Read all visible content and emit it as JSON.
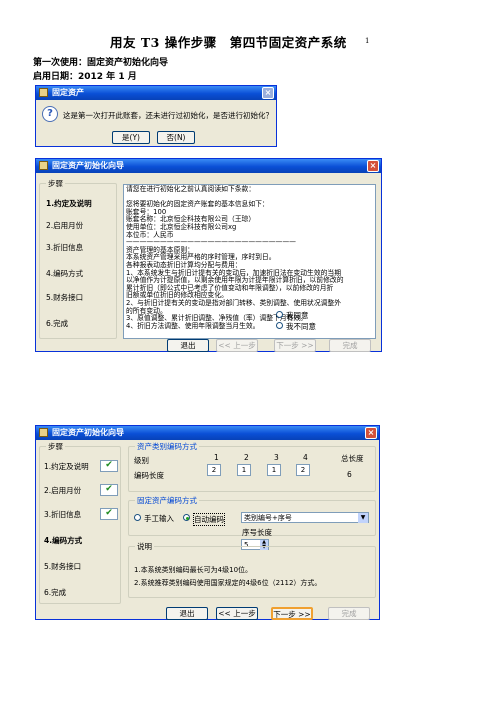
{
  "document": {
    "title": "用友 T3 操作步骤　第四节固定资产系统",
    "page_number": "1",
    "first_use": "第一次使用：固定资产初始化向导",
    "start_date": "启用日期：2012 年 1 月"
  },
  "dialog1": {
    "title": "固定资产",
    "message": "这是第一次打开此账套，还未进行过初始化，是否进行初始化？",
    "yes_label": "是(Y)",
    "no_label": "否(N)"
  },
  "wizard1": {
    "title": "固定资产初始化向导",
    "steps_group": "步骤",
    "steps": [
      "1.约定及说明",
      "2.启用月份",
      "3.折旧信息",
      "4.编码方式",
      "5.财务接口",
      "6.完成"
    ],
    "text_lines": [
      "请您在进行初始化之前认真阅读如下条款：",
      "",
      "您将要初始化的固定资产账套的基本信息如下：",
      "账套号：100",
      "账套名称：北京恒企科技有限公司（王琼）",
      "使用单位：北京恒企科技有限公司xg",
      "本位币：人民币",
      "—————————————————————————",
      "资产管理的基本原则：",
      "本系统资产管理采用严格的序时管理，序时到日。",
      "各种报表动态折旧计算均分配与费用：",
      "1、本系统发生与折旧计提有关的变动后，加速折旧法在变动生效的当期",
      "以净值作为计提原值，以剩余使用年限为计提年限计算折旧，以前修改的",
      "累计折旧（即公式中已考虑了价值变动和年限调整），以前修改的月折",
      "旧额或单位折旧的修改相应变化。",
      "2、与折旧计提有关的变动是指对部门转移、类别调整、使用状况调整外",
      "的所有变动。",
      "3、原值调整、累计折旧调整、净残值（率）调整下月有效。",
      "4、折旧方法调整、使用年限调整当月生效。"
    ],
    "agree_label": "我同意",
    "disagree_label": "我不同意",
    "exit_label": "退出",
    "prev_label": "<< 上一步",
    "next_label": "下一步 >>",
    "finish_label": "完成"
  },
  "wizard2": {
    "title": "固定资产初始化向导",
    "steps_group": "步骤",
    "steps": [
      "1.约定及说明",
      "2.启用月份",
      "3.折旧信息",
      "4.编码方式",
      "5.财务接口",
      "6.完成"
    ],
    "category_group": "资产类别编码方式",
    "level_label": "级别",
    "level_numbers": [
      "1",
      "2",
      "3",
      "4"
    ],
    "code_length_label": "编码长度",
    "code_lengths": [
      "2",
      "1",
      "1",
      "2"
    ],
    "total_levels_label": "总长度",
    "total_length": "6",
    "asset_group": "固定资产编码方式",
    "manual_label": "手工输入",
    "auto_label": "自动编码",
    "auto_select_value": "类别编号+序号",
    "seq_length_label": "序号长度",
    "seq_length_value": "5",
    "note_group": "说明",
    "notes": [
      "1.本系统类别编码最长可为4级10位。",
      "2.系统推荐类别编码使用国家规定的4级6位（2112）方式。"
    ],
    "exit_label": "退出",
    "prev_label": "<< 上一步",
    "next_label": "下一步 >>",
    "finish_label": "完成"
  }
}
